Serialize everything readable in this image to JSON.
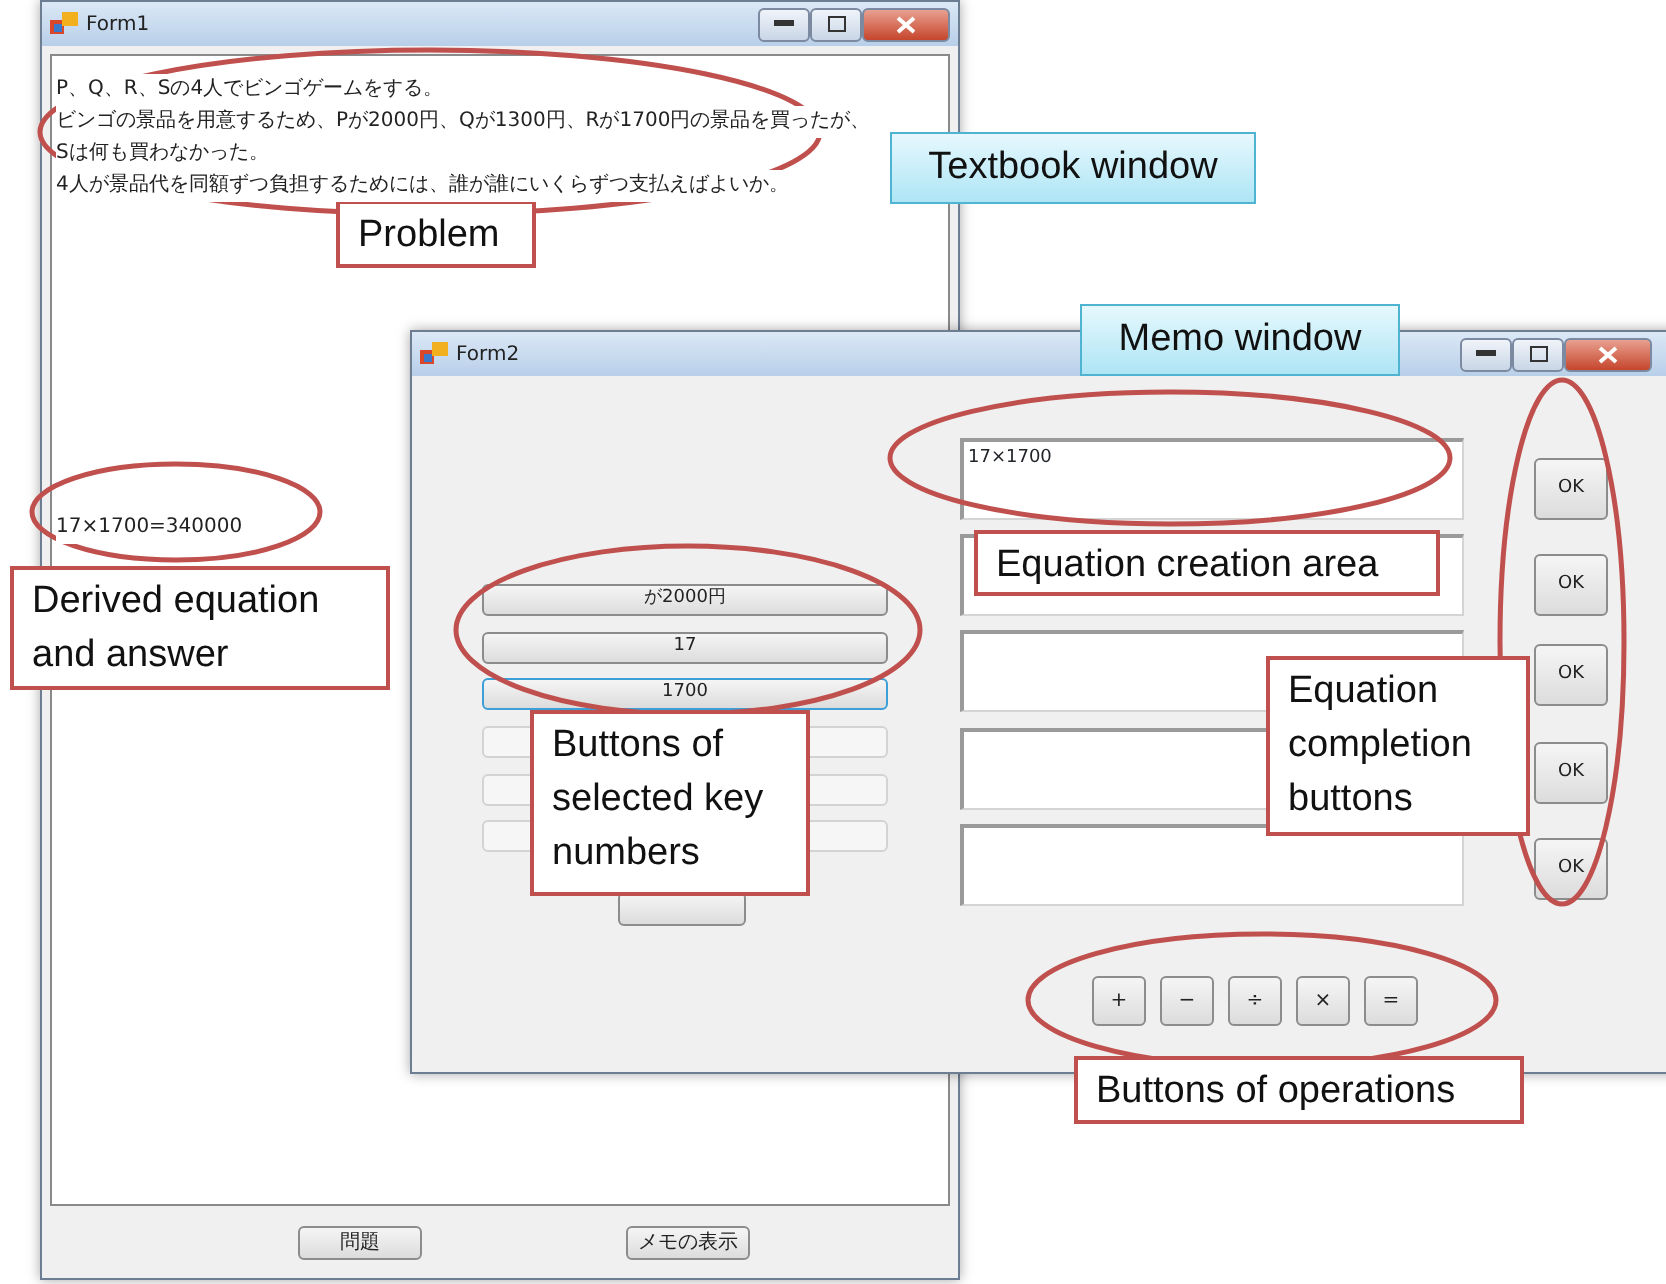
{
  "textbook_window": {
    "title": "Form1",
    "problem_lines": [
      "P、Q、R、Sの4人でビンゴゲームをする。",
      "ビンゴの景品を用意するため、Pが2000円、Qが1300円、Rが1700円の景品を買ったが、",
      "Sは何も買わなかった。",
      "4人が景品代を同額ずつ負担するためには、誰が誰にいくらずつ支払えばよいか。"
    ],
    "derived_equation": "17×1700=340000",
    "buttons": [
      "問題",
      "メモの表示"
    ]
  },
  "memo_window": {
    "title": "Form2",
    "key_number_buttons": [
      {
        "kind": "number",
        "label": "が2000円",
        "focused": false
      },
      {
        "kind": "number",
        "label": "17",
        "focused": false
      },
      {
        "kind": "number",
        "label": "1700",
        "focused": true
      },
      {
        "kind": "blank"
      },
      {
        "kind": "blank"
      },
      {
        "kind": "blank"
      }
    ],
    "equation_fields": [
      {
        "kind": "filled",
        "value": "17×1700"
      },
      {
        "kind": "empty"
      },
      {
        "kind": "empty"
      },
      {
        "kind": "empty"
      },
      {
        "kind": "empty"
      }
    ],
    "completion_buttons": [
      "OK",
      "OK",
      "OK",
      "OK",
      "OK"
    ],
    "operation_buttons": [
      "+",
      "−",
      "÷",
      "×",
      "="
    ]
  },
  "annotations": [
    {
      "kind": "label",
      "text": "Textbook window"
    },
    {
      "kind": "label",
      "text": "Memo window"
    },
    {
      "kind": "callout",
      "text": "Problem"
    },
    {
      "kind": "callout",
      "text": "Derived equation and answer"
    },
    {
      "kind": "callout",
      "text": "Equation creation area"
    },
    {
      "kind": "callout",
      "text": "Buttons of selected key numbers"
    },
    {
      "kind": "callout",
      "text": "Equation completion buttons"
    },
    {
      "kind": "callout",
      "text": "Buttons of operations"
    }
  ]
}
